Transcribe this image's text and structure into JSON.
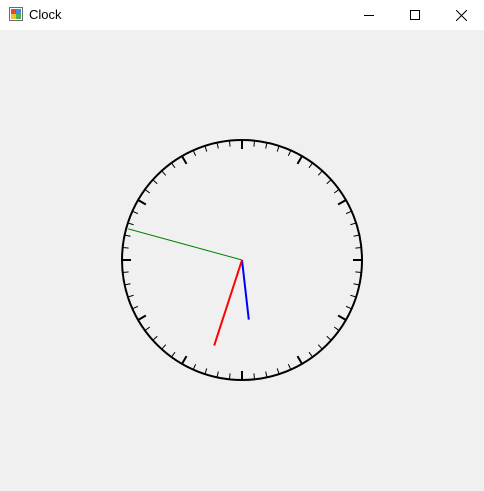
{
  "window": {
    "title": "Clock",
    "app_icon": "winforms-app-icon",
    "controls": {
      "minimize_icon": "minimize-icon",
      "maximize_icon": "maximize-icon",
      "close_icon": "close-icon"
    }
  },
  "clock": {
    "time": {
      "hour": 5,
      "minute": 47,
      "second": 33
    },
    "hand_colors": {
      "hour": "#0000ff",
      "minute": "#008000",
      "second": "#ff0000"
    },
    "face_color": "#000000",
    "face_fill": "#f0f0f0"
  }
}
